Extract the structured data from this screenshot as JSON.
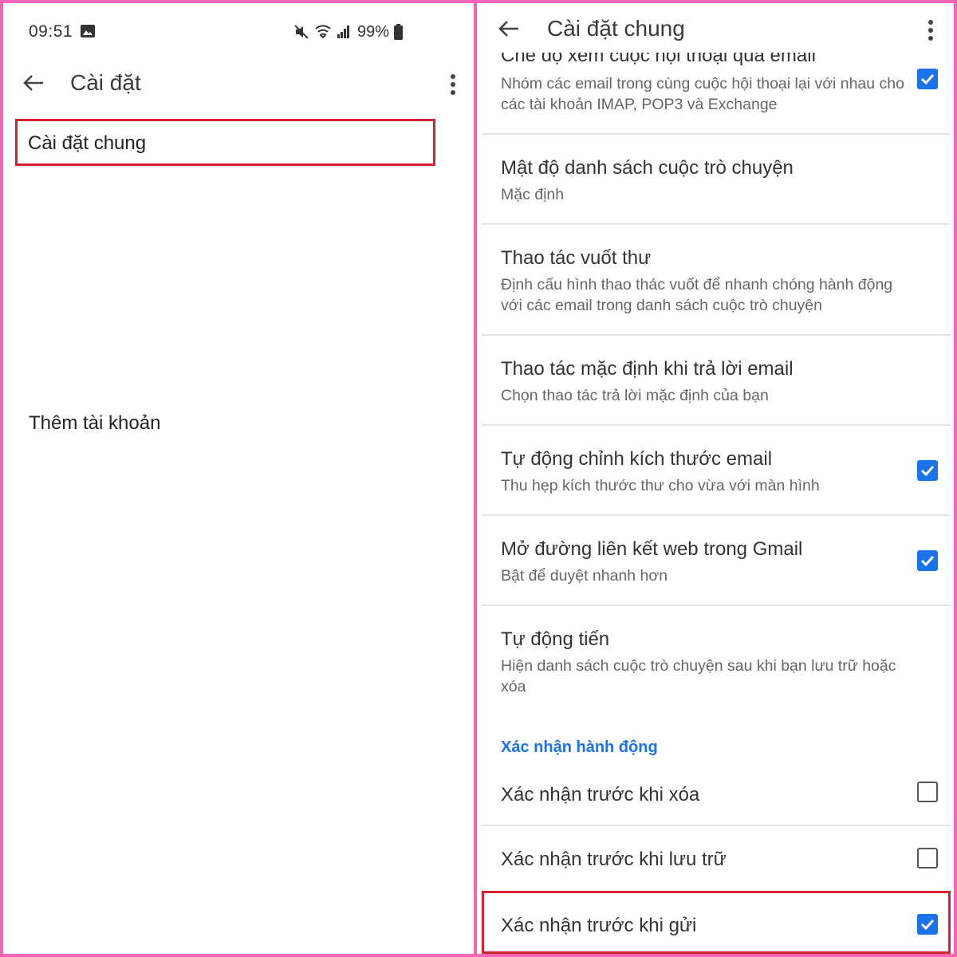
{
  "colors": {
    "frame": "#f266b6",
    "highlight": "#d4232f",
    "accent": "#1a73e8"
  },
  "left": {
    "status": {
      "time": "09:51",
      "battery": "99%"
    },
    "toolbar": {
      "back_icon": "back-arrow-icon",
      "title": "Cài đặt",
      "more_icon": "more-vert-icon"
    },
    "items": [
      {
        "label": "Cài đặt chung"
      },
      {
        "label": "Thêm tài khoản"
      }
    ]
  },
  "right": {
    "toolbar": {
      "back_icon": "back-arrow-icon",
      "title": "Cài đặt chung",
      "more_icon": "more-vert-icon"
    },
    "rows": [
      {
        "title": "Chế độ xem cuộc hội thoại qua email",
        "subtitle": "Nhóm các email trong cùng cuộc hội thoại lại với nhau cho các tài khoản IMAP, POP3 và Exchange",
        "checked": true
      },
      {
        "title": "Mật độ danh sách cuộc trò chuyện",
        "subtitle": "Mặc định"
      },
      {
        "title": "Thao tác vuốt thư",
        "subtitle": "Định cấu hình thao thác vuốt để nhanh chóng hành động với các email trong danh sách cuộc trò chuyện"
      },
      {
        "title": "Thao tác mặc định khi trả lời email",
        "subtitle": "Chọn thao tác trả lời mặc định của bạn"
      },
      {
        "title": "Tự động chỉnh kích thước email",
        "subtitle": "Thu hẹp kích thước thư cho vừa với màn hình",
        "checked": true
      },
      {
        "title": "Mở đường liên kết web trong Gmail",
        "subtitle": "Bật để duyệt nhanh hơn",
        "checked": true
      },
      {
        "title": "Tự động tiến",
        "subtitle": "Hiện danh sách cuộc trò chuyện sau khi bạn lưu trữ hoặc xóa"
      }
    ],
    "section": "Xác nhận hành động",
    "confirm_rows": [
      {
        "title": "Xác nhận trước khi xóa",
        "checked": false
      },
      {
        "title": "Xác nhận trước khi lưu trữ",
        "checked": false
      },
      {
        "title": "Xác nhận trước khi gửi",
        "checked": true
      }
    ]
  }
}
